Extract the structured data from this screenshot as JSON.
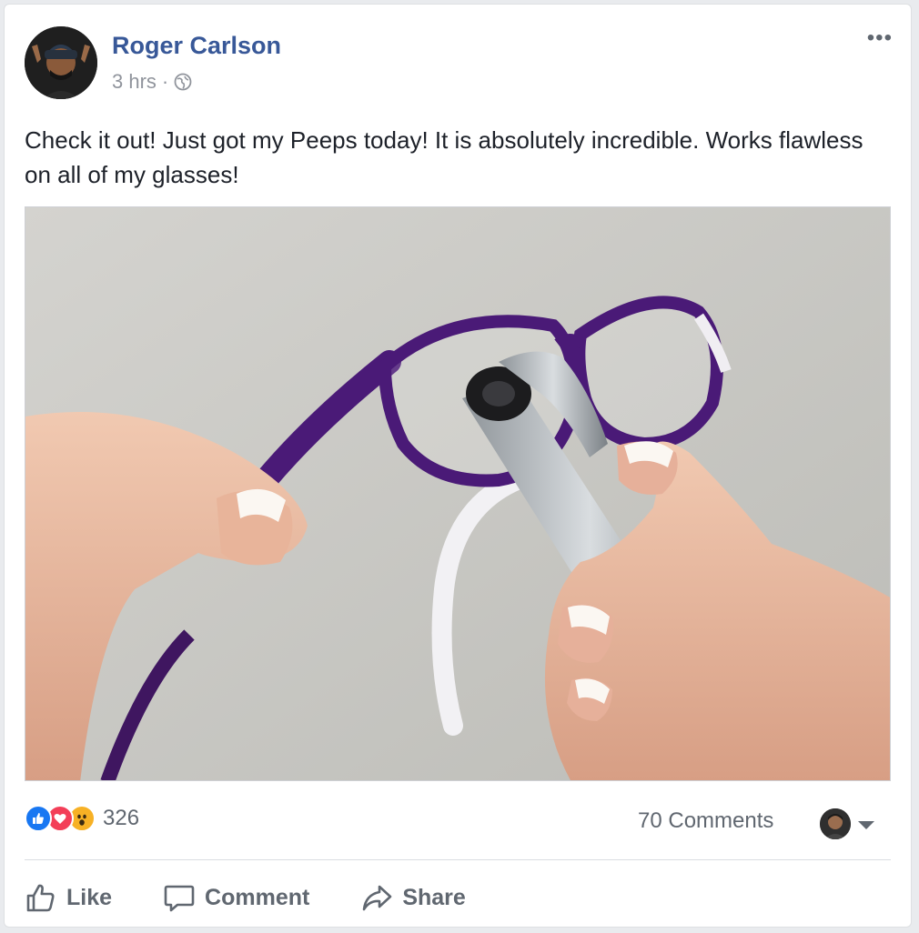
{
  "post": {
    "author": "Roger Carlson",
    "timestamp": "3 hrs",
    "separator": "·",
    "privacy_icon": "globe-icon",
    "more_label": "•••",
    "text": "Check it out! Just got my Peeps today! It is absolutely incredible. Works flawless on all of my glasses!"
  },
  "engagement": {
    "reaction_icons": [
      "like-reaction-icon",
      "love-reaction-icon",
      "wow-reaction-icon"
    ],
    "reaction_count": "326",
    "comments_label": "70 Comments"
  },
  "actions": {
    "like_label": "Like",
    "comment_label": "Comment",
    "share_label": "Share"
  },
  "colors": {
    "author_link": "#385898",
    "meta_gray": "#90949c",
    "action_gray": "#606770",
    "like_blue": "#1877f2",
    "love_red": "#f33e58",
    "wow_yellow": "#f7b125"
  }
}
